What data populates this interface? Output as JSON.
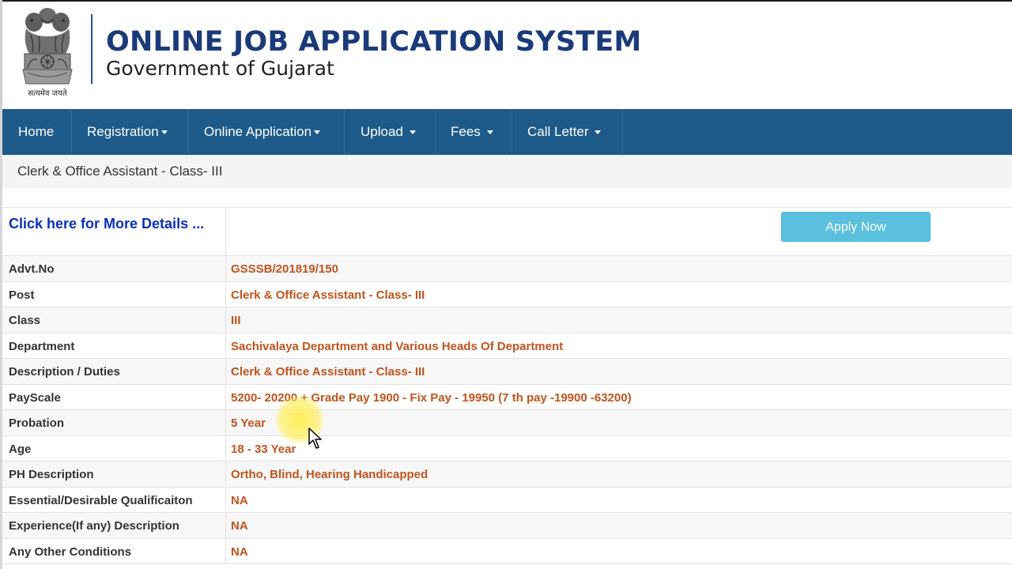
{
  "header": {
    "title": "ONLINE JOB APPLICATION SYSTEM",
    "subtitle": "Government of Gujarat",
    "emblem_motto": "सत्यमेव जयते",
    "emblem_icon": "ashoka-emblem-icon"
  },
  "nav": {
    "items": [
      {
        "label": "Home",
        "dropdown": false
      },
      {
        "label": "Registration",
        "dropdown": true
      },
      {
        "label": "Online Application",
        "dropdown": true
      },
      {
        "label": "Upload",
        "dropdown": true
      },
      {
        "label": "Fees",
        "dropdown": true
      },
      {
        "label": "Call Letter",
        "dropdown": true
      }
    ],
    "color": "#1e5a8a"
  },
  "breadcrumb": {
    "text": "Clerk & Office Assistant - Class- III"
  },
  "details": {
    "more_link": "Click here for More Details ...",
    "apply_label": "Apply Now",
    "rows": [
      {
        "label": "Advt.No",
        "value": "GSSSB/201819/150"
      },
      {
        "label": "Post",
        "value": "Clerk & Office Assistant - Class- III"
      },
      {
        "label": "Class",
        "value": "III"
      },
      {
        "label": "Department",
        "value": "Sachivalaya Department and Various Heads Of Department"
      },
      {
        "label": "Description / Duties",
        "value": "Clerk & Office Assistant - Class- III"
      },
      {
        "label": "PayScale",
        "value": "5200- 20200 + Grade Pay 1900 - Fix Pay - 19950 (7 th pay -19900 -63200)"
      },
      {
        "label": "Probation",
        "value": "5 Year"
      },
      {
        "label": "Age",
        "value": "18 - 33 Year"
      },
      {
        "label": "PH Description",
        "value": "Ortho, Blind, Hearing Handicapped"
      },
      {
        "label": "Essential/Desirable Qualificaiton",
        "value": "NA"
      },
      {
        "label": "Experience(If any) Description",
        "value": "NA"
      },
      {
        "label": "Any Other Conditions",
        "value": "NA"
      }
    ],
    "label_color": "#333333",
    "value_color": "#c0541f",
    "link_color": "#0b2fb8",
    "apply_color": "#5bc0de"
  }
}
